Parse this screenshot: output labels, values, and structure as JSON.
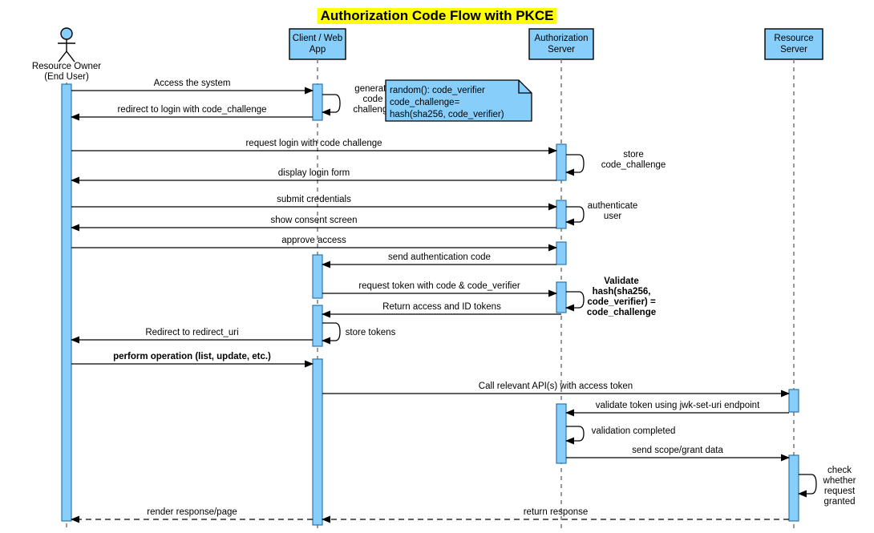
{
  "title": "Authorization Code Flow with PKCE",
  "title_highlight_color": "#ffff00",
  "colors": {
    "participant_fill": "#87cefa",
    "activation_fill": "#87cefa",
    "activation_stroke": "#2e74a6",
    "note_fill": "#87cefa",
    "line": "#000000",
    "lifeline": "#808080"
  },
  "participants": [
    {
      "id": "owner",
      "type": "actor",
      "label_line1": "Resource Owner",
      "label_line2": "(End User)"
    },
    {
      "id": "client",
      "type": "box",
      "label_line1": "Client / Web",
      "label_line2": "App"
    },
    {
      "id": "auth",
      "type": "box",
      "label_line1": "Authorization",
      "label_line2": "Server"
    },
    {
      "id": "resource",
      "type": "box",
      "label_line1": "Resource",
      "label_line2": "Server"
    }
  ],
  "note": {
    "lines": [
      "random(): code_verifier",
      "code_challenge=",
      "hash(sha256, code_verifier)"
    ]
  },
  "messages": [
    {
      "id": "m1",
      "label": "Access the system",
      "from": "owner",
      "to": "client",
      "style": "solid",
      "bold": false
    },
    {
      "id": "m2",
      "label": "redirect to login with code_challenge",
      "from": "client",
      "to": "owner",
      "style": "solid",
      "bold": false
    },
    {
      "id": "m3",
      "label": "request login with code  challenge",
      "from": "owner",
      "to": "auth",
      "style": "solid",
      "bold": false
    },
    {
      "id": "m4",
      "label": "display login form",
      "from": "auth",
      "to": "owner",
      "style": "solid",
      "bold": false
    },
    {
      "id": "m5",
      "label": "submit credentials",
      "from": "owner",
      "to": "auth",
      "style": "solid",
      "bold": false
    },
    {
      "id": "m6",
      "label": "show consent screen",
      "from": "auth",
      "to": "owner",
      "style": "solid",
      "bold": false
    },
    {
      "id": "m7",
      "label": "approve access",
      "from": "owner",
      "to": "auth",
      "style": "solid",
      "bold": false
    },
    {
      "id": "m8",
      "label": "send authentication code",
      "from": "auth",
      "to": "client",
      "style": "solid",
      "bold": false
    },
    {
      "id": "m9",
      "label": "request token with code & code_verifier",
      "from": "client",
      "to": "auth",
      "style": "solid",
      "bold": false
    },
    {
      "id": "m10",
      "label": "Return access and ID tokens",
      "from": "auth",
      "to": "client",
      "style": "solid",
      "bold": false
    },
    {
      "id": "m11",
      "label": "Redirect to redirect_uri",
      "from": "client",
      "to": "owner",
      "style": "solid",
      "bold": false
    },
    {
      "id": "m12",
      "label": "perform operation (list, update, etc.)",
      "from": "owner",
      "to": "client",
      "style": "solid",
      "bold": true
    },
    {
      "id": "m13",
      "label": "Call relevant API(s) with access token",
      "from": "client",
      "to": "resource",
      "style": "solid",
      "bold": false
    },
    {
      "id": "m14",
      "label": "validate token using jwk-set-uri endpoint",
      "from": "resource",
      "to": "auth",
      "style": "solid",
      "bold": false
    },
    {
      "id": "m15",
      "label": "send scope/grant data",
      "from": "auth",
      "to": "resource",
      "style": "solid",
      "bold": false
    },
    {
      "id": "m16",
      "label": "return response",
      "from": "resource",
      "to": "client",
      "style": "dashed",
      "bold": false
    },
    {
      "id": "m17",
      "label": "render response/page",
      "from": "client",
      "to": "owner",
      "style": "dashed",
      "bold": false
    }
  ],
  "self_messages": [
    {
      "id": "s1",
      "on": "client",
      "lines": [
        "generate",
        "code",
        "challenge"
      ],
      "side": "right",
      "bold": false
    },
    {
      "id": "s2",
      "on": "auth",
      "lines": [
        "store",
        "code_challenge"
      ],
      "side": "right",
      "bold": false
    },
    {
      "id": "s3",
      "on": "auth",
      "lines": [
        "authenticate",
        "user"
      ],
      "side": "right",
      "bold": false
    },
    {
      "id": "s4",
      "on": "auth",
      "lines": [
        "Validate",
        "hash(sha256,",
        "code_verifier) =",
        "code_challenge"
      ],
      "side": "right",
      "bold": true
    },
    {
      "id": "s5",
      "on": "client",
      "lines": [
        "store tokens"
      ],
      "side": "right",
      "bold": false
    },
    {
      "id": "s6",
      "on": "auth",
      "lines": [
        "validation completed"
      ],
      "side": "right",
      "bold": false
    },
    {
      "id": "s7",
      "on": "resource",
      "lines": [
        "check",
        "whether",
        "request",
        "granted"
      ],
      "side": "right",
      "bold": false
    }
  ]
}
